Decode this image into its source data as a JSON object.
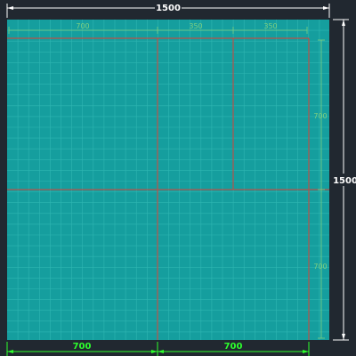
{
  "drawing": {
    "background_color": "#212830",
    "fill_color": "#159e9e",
    "grid_line_color": "#2fb6b2",
    "division_line_color": "#b8524a",
    "dimension_white": "#ffffff",
    "dimension_green": "#2dff2d",
    "dimension_green_dim": "#7fd07f"
  },
  "dimensions": {
    "overall_width": "1500",
    "overall_height": "1500",
    "top_left_span": "700",
    "top_mid_span": "350",
    "top_right_span": "350",
    "right_upper_span": "700",
    "right_lower_span": "700",
    "bottom_left_span": "700",
    "bottom_right_span": "700"
  }
}
